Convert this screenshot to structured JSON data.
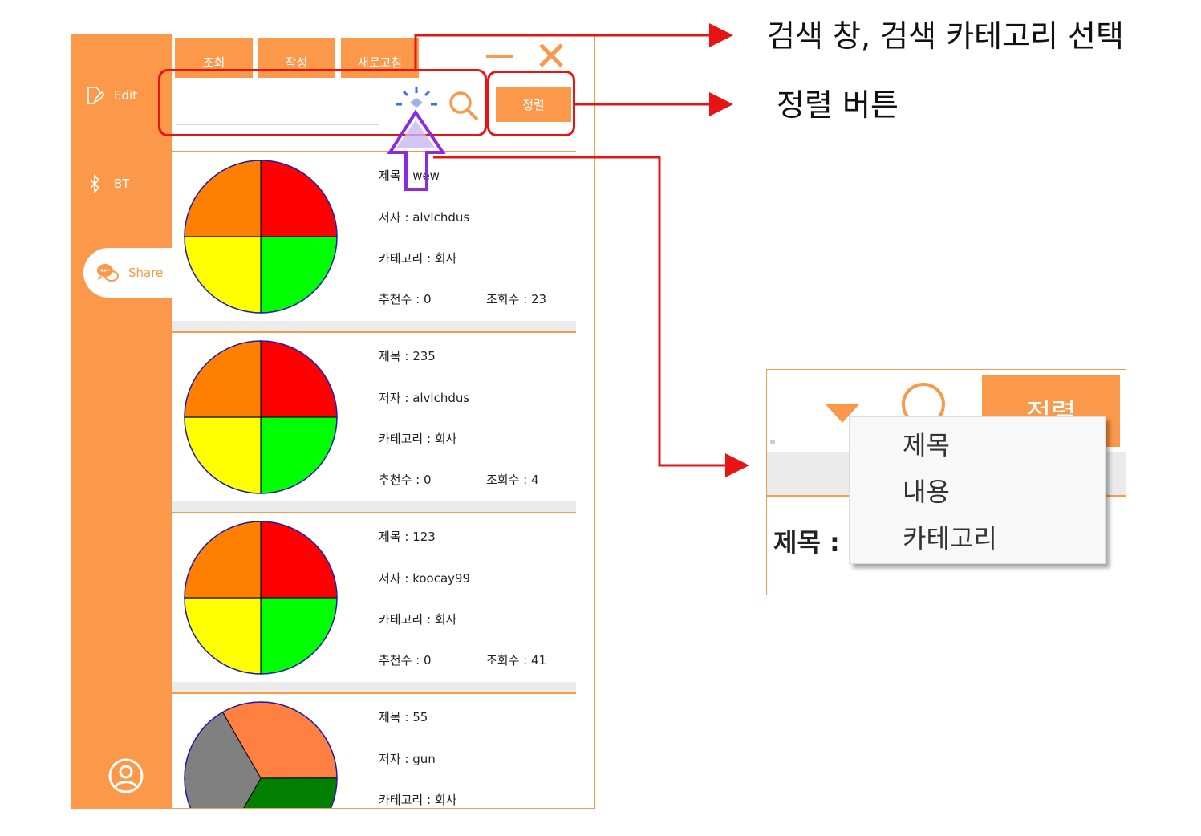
{
  "sidebar": {
    "items": [
      {
        "label": "Edit",
        "icon": "edit-icon"
      },
      {
        "label": "BT",
        "icon": "bluetooth-icon"
      },
      {
        "label": "Share",
        "icon": "chat-bubbles-icon",
        "active": true
      }
    ],
    "profile_icon": "user-icon"
  },
  "toolbar": {
    "view_label": "조회",
    "write_label": "작성",
    "refresh_label": "새로고침",
    "sort_label": "정렬",
    "search_placeholder": ""
  },
  "posts": [
    {
      "title": "제목 : wew",
      "author": "저자 : alvlchdus",
      "category": "카테고리 : 회사",
      "likes": "추천수 : 0",
      "views": "조회수 : 23",
      "pie": "four",
      "values": [
        25,
        25,
        25,
        25
      ]
    },
    {
      "title": "제목 : 235",
      "author": "저자 : alvlchdus",
      "category": "카테고리 : 회사",
      "likes": "추천수 : 0",
      "views": "조회수 : 4",
      "pie": "four",
      "values": [
        25,
        25,
        25,
        25
      ]
    },
    {
      "title": "제목 : 123",
      "author": "저자 : koocay99",
      "category": "카테고리 : 회사",
      "likes": "추천수 : 0",
      "views": "조회수 : 41",
      "pie": "four",
      "values": [
        25,
        25,
        25,
        25
      ]
    },
    {
      "title": "제목 : 55",
      "author": "저자 : gun",
      "category": "카테고리 : 회사",
      "likes": "",
      "views": "",
      "pie": "three",
      "values": [
        33.3,
        33.3,
        33.4
      ]
    }
  ],
  "annotations": {
    "search_label": "검색 창, 검색 카테고리 선택",
    "sort_label": "정렬 버튼"
  },
  "inset": {
    "sort_label": "정렬",
    "title_fragment": "제목 :",
    "dropdown_options": [
      "제목",
      "내용",
      "카테고리"
    ]
  },
  "colors": {
    "accent": "#fb9849",
    "annotation": "#e81414",
    "pie_orange": "#ff7f00",
    "pie_red": "#ff0000",
    "pie_yellow": "#ffff00",
    "pie_green": "#00ff00",
    "pie_gray": "#808080",
    "pie_dark_green": "#007f00",
    "pie_light_orange": "#ff8040"
  }
}
